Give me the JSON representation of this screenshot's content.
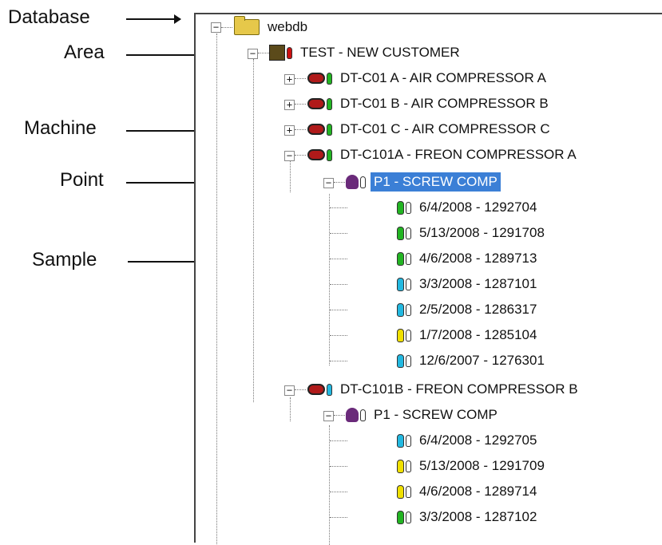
{
  "annotations": {
    "database": "Database",
    "area": "Area",
    "machine": "Machine",
    "point": "Point",
    "sample": "Sample"
  },
  "colors": {
    "green": "#22b422",
    "cyan": "#22b8e0",
    "yellow": "#f0e000",
    "red": "#cc1111",
    "selection": "#3b7fd6"
  },
  "tree": {
    "database": "webdb",
    "area": "TEST - NEW CUSTOMER",
    "machines": [
      {
        "label": "DT-C01 A - AIR COMPRESSOR A"
      },
      {
        "label": "DT-C01 B - AIR COMPRESSOR B"
      },
      {
        "label": "DT-C01 C - AIR COMPRESSOR C"
      },
      {
        "label": "DT-C101A - FREON COMPRESSOR A"
      },
      {
        "label": "DT-C101B - FREON COMPRESSOR B"
      }
    ],
    "point_a": "P1 - SCREW COMP",
    "samples_a": [
      {
        "label": "6/4/2008 - 1292704",
        "status": "green"
      },
      {
        "label": "5/13/2008 - 1291708",
        "status": "green"
      },
      {
        "label": "4/6/2008 - 1289713",
        "status": "green"
      },
      {
        "label": "3/3/2008 - 1287101",
        "status": "cyan"
      },
      {
        "label": "2/5/2008 - 1286317",
        "status": "cyan"
      },
      {
        "label": "1/7/2008 - 1285104",
        "status": "yellow"
      },
      {
        "label": "12/6/2007 - 1276301",
        "status": "cyan"
      }
    ],
    "point_b": "P1 - SCREW COMP",
    "samples_b": [
      {
        "label": "6/4/2008 - 1292705",
        "status": "cyan"
      },
      {
        "label": "5/13/2008 - 1291709",
        "status": "yellow"
      },
      {
        "label": "4/6/2008 - 1289714",
        "status": "yellow"
      },
      {
        "label": "3/3/2008 - 1287102",
        "status": "green"
      }
    ]
  }
}
